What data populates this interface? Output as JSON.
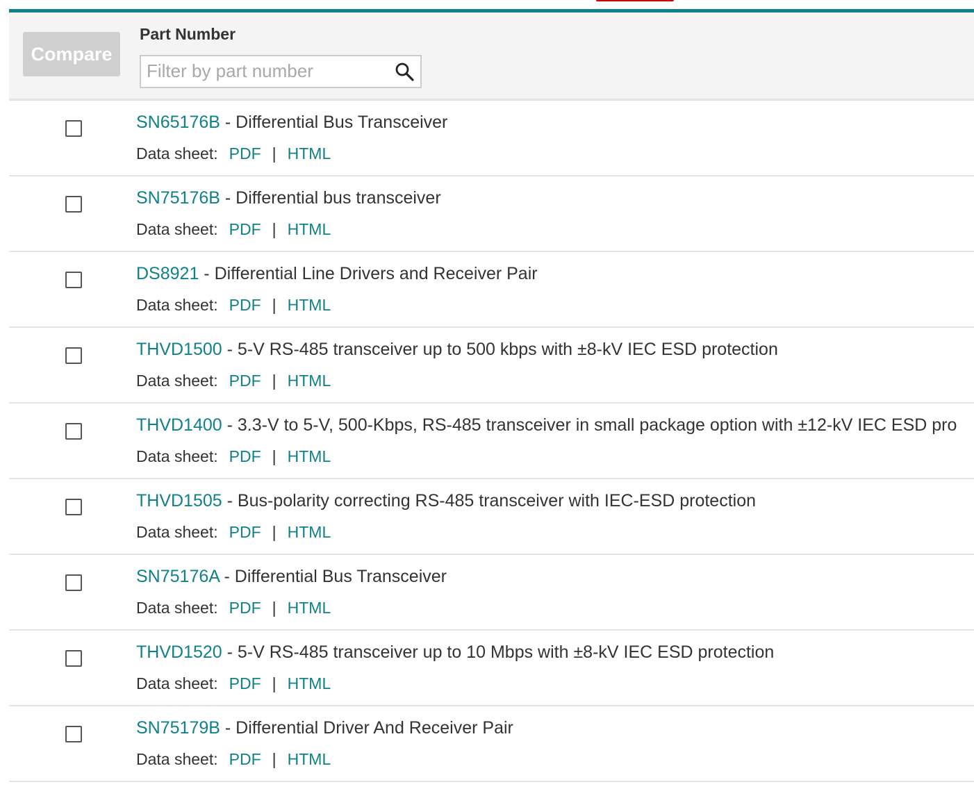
{
  "colors": {
    "accent": "#118189",
    "compare_button_bg": "#cfcfcf",
    "top_tab": "#cc0000"
  },
  "toolbar": {
    "compare_label": "Compare",
    "part_number_label": "Part Number",
    "filter_placeholder": "Filter by part number",
    "search_icon": "search-icon"
  },
  "parts": [
    {
      "part": "SN65176B",
      "separator": " - ",
      "description": "Differential Bus Transceiver",
      "ds_label": "Data sheet:",
      "pdf": "PDF",
      "pipe": "|",
      "html": "HTML"
    },
    {
      "part": "SN75176B",
      "separator": " - ",
      "description": "Differential bus transceiver",
      "ds_label": "Data sheet:",
      "pdf": "PDF",
      "pipe": "|",
      "html": "HTML"
    },
    {
      "part": "DS8921",
      "separator": " - ",
      "description": "Differential Line Drivers and Receiver Pair",
      "ds_label": "Data sheet:",
      "pdf": "PDF",
      "pipe": "|",
      "html": "HTML"
    },
    {
      "part": "THVD1500",
      "separator": " - ",
      "description": "5-V RS-485 transceiver up to 500 kbps with ±8-kV IEC ESD protection",
      "ds_label": "Data sheet:",
      "pdf": "PDF",
      "pipe": "|",
      "html": "HTML"
    },
    {
      "part": "THVD1400",
      "separator": " - ",
      "description": "3.3-V to 5-V, 500-Kbps, RS-485 transceiver in small package option with ±12-kV IEC ESD pro",
      "ds_label": "Data sheet:",
      "pdf": "PDF",
      "pipe": "|",
      "html": "HTML"
    },
    {
      "part": "THVD1505",
      "separator": " - ",
      "description": "Bus-polarity correcting RS-485 transceiver with IEC-ESD protection",
      "ds_label": "Data sheet:",
      "pdf": "PDF",
      "pipe": "|",
      "html": "HTML"
    },
    {
      "part": "SN75176A",
      "separator": " - ",
      "description": "Differential Bus Transceiver",
      "ds_label": "Data sheet:",
      "pdf": "PDF",
      "pipe": "|",
      "html": "HTML"
    },
    {
      "part": "THVD1520",
      "separator": " - ",
      "description": "5-V RS-485 transceiver up to 10 Mbps with ±8-kV IEC ESD protection",
      "ds_label": "Data sheet:",
      "pdf": "PDF",
      "pipe": "|",
      "html": "HTML"
    },
    {
      "part": "SN75179B",
      "separator": " - ",
      "description": "Differential Driver And Receiver Pair",
      "ds_label": "Data sheet:",
      "pdf": "PDF",
      "pipe": "|",
      "html": "HTML"
    }
  ]
}
